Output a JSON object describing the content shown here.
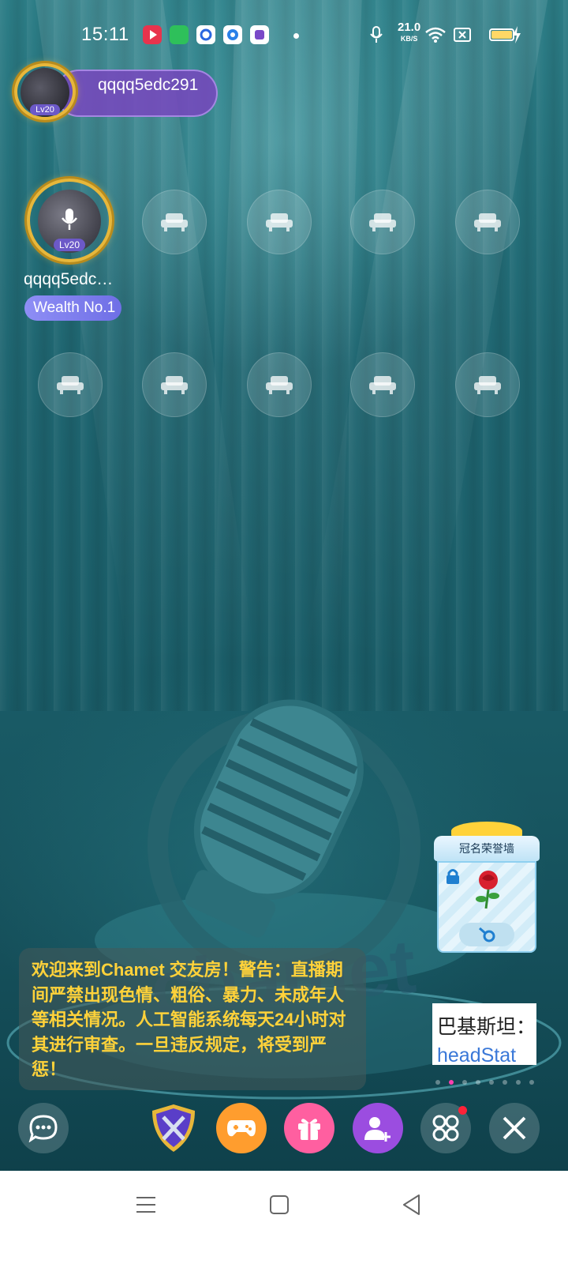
{
  "status_bar": {
    "time": "15:11",
    "net_speed_value": "21.0",
    "net_speed_unit": "KB/S",
    "battery_color": "#ffd866"
  },
  "host": {
    "name": "qqqq5edc291",
    "level": "Lv20"
  },
  "seat1": {
    "name": "qqqq5edc…",
    "level": "Lv20",
    "badge": "Wealth No.1"
  },
  "empty_seat_icon": "sofa-icon",
  "notice": {
    "text": "欢迎来到Chamet 交友房！警告：直播期间严禁出现色情、粗俗、暴力、未成年人等相关情况。人工智能系统每天24小时对其进行审查。一旦违反规定，将受到严惩！"
  },
  "honor_wall": {
    "title": "冠名荣誉墙"
  },
  "promo": {
    "line1": "巴基斯坦：",
    "line2": "headStat"
  },
  "background_text": "chamet",
  "toolbar": {
    "chat": "chat-bubble-icon",
    "pk": "pk-shield-icon",
    "game": "gamepad-icon",
    "gift": "gift-icon",
    "invite": "add-user-icon",
    "more": "more-apps-icon",
    "close": "close-icon"
  },
  "colors": {
    "notice_text": "#ffd23a",
    "pk_accent": "#e8b73a",
    "game": "#ff9d2e",
    "gift": "#ff5fa0",
    "invite": "#9b4de0"
  }
}
